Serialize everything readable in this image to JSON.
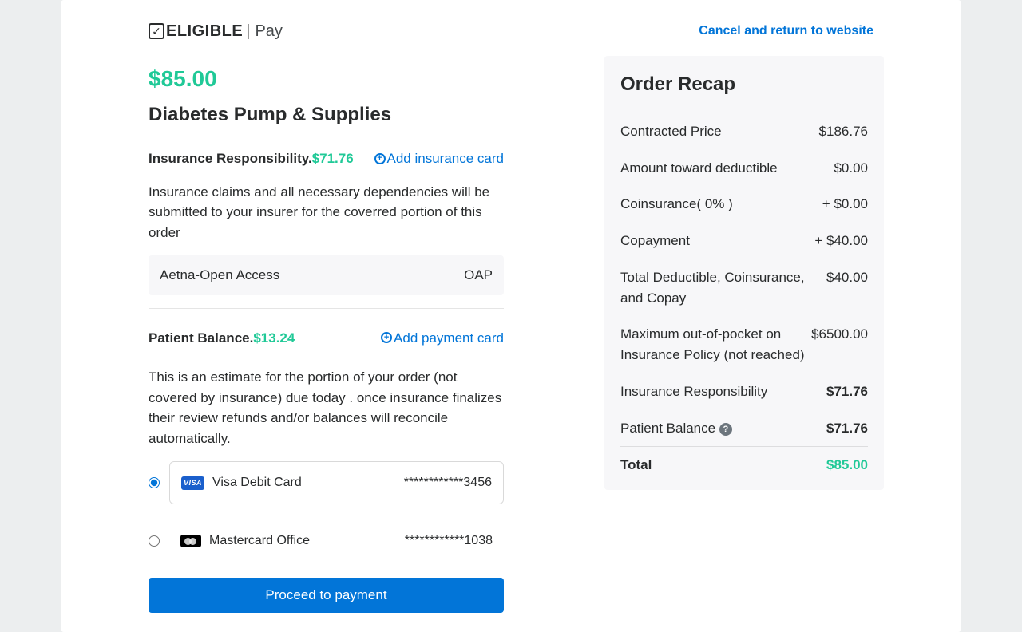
{
  "brand": {
    "name": "ELIGIBLE",
    "suffix": "Pay"
  },
  "header": {
    "cancel_label": "Cancel and return to website"
  },
  "order": {
    "price": "$85.00",
    "product_title": "Diabetes Pump & Supplies"
  },
  "insurance": {
    "label": "Insurance Responsibility.",
    "amount": "$71.76",
    "add_card_label": "Add insurance card",
    "description": "Insurance claims and all necessary dependencies will be submitted to your insurer for the coverred portion of this order",
    "plan_name": "Aetna-Open Access",
    "plan_code": "OAP"
  },
  "patient": {
    "label": "Patient Balance.",
    "amount": "$13.24",
    "add_card_label": "Add payment card",
    "description": "This is an estimate for the portion of your order (not covered by insurance) due today . once insurance finalizes their review refunds and/or balances will reconcile automatically."
  },
  "cards": [
    {
      "name": "Visa Debit Card",
      "masked": "************3456",
      "selected": true,
      "brand": "visa"
    },
    {
      "name": "Mastercard Office",
      "masked": "************1038",
      "selected": false,
      "brand": "mastercard"
    }
  ],
  "actions": {
    "proceed_label": "Proceed to payment"
  },
  "recap": {
    "title": "Order Recap",
    "rows": {
      "contracted_price": {
        "label": "Contracted Price",
        "value": "$186.76"
      },
      "deductible": {
        "label": "Amount toward deductible",
        "value": "$0.00"
      },
      "coinsurance": {
        "label": "Coinsurance( 0% )",
        "value": "+ $0.00"
      },
      "copayment": {
        "label": "Copayment",
        "value": "+ $40.00"
      },
      "total_dcc": {
        "label": "Total Deductible, Coinsurance, and Copay",
        "value": "$40.00"
      },
      "max_oop": {
        "label": "Maximum out-of-pocket on Insurance Policy (not reached)",
        "value": "$6500.00"
      },
      "insurance_resp": {
        "label": "Insurance Responsibility",
        "value": "$71.76"
      },
      "patient_balance": {
        "label": "Patient Balance",
        "value": "$71.76"
      },
      "total": {
        "label": "Total",
        "value": "$85.00"
      }
    }
  }
}
